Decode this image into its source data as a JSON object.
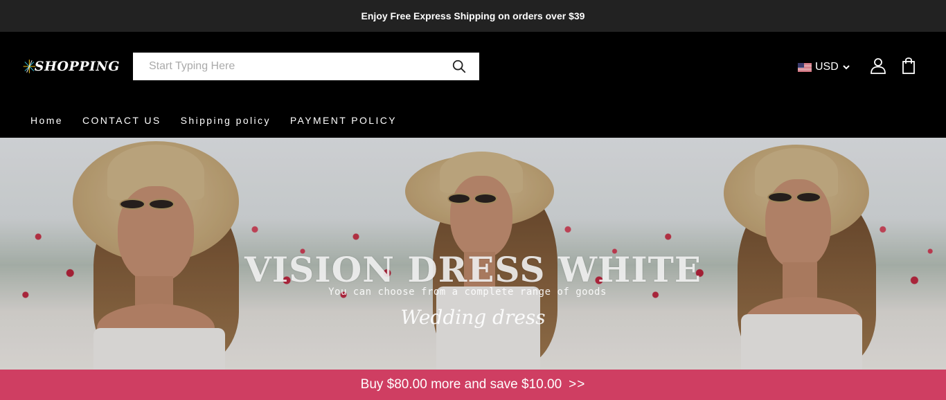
{
  "announcement": {
    "text": "Enjoy Free Express Shipping on orders over $39"
  },
  "header": {
    "logo_text": "SHOPPING",
    "search": {
      "placeholder": "Start Typing Here",
      "value": ""
    },
    "currency": {
      "code": "USD",
      "flag": "us-flag-icon"
    },
    "icons": [
      "search-icon",
      "us-flag-icon",
      "chevron-down-icon",
      "account-icon",
      "cart-icon"
    ]
  },
  "nav": {
    "items": [
      {
        "label": "Home"
      },
      {
        "label": "CONTACT US"
      },
      {
        "label": "Shipping policy"
      },
      {
        "label": "PAYMENT POLICY"
      }
    ]
  },
  "hero": {
    "title": "VISION DRESS WHITE",
    "subtitle": "You can choose from a complete range of goods",
    "script_text": "Wedding dress"
  },
  "promo_bar": {
    "text": "Buy $80.00 more and save $10.00",
    "arrows": ">>"
  },
  "colors": {
    "announcement_bg": "#222222",
    "header_bg": "#000000",
    "promo_bg": "#cf3e62",
    "text_light": "#ffffff"
  }
}
